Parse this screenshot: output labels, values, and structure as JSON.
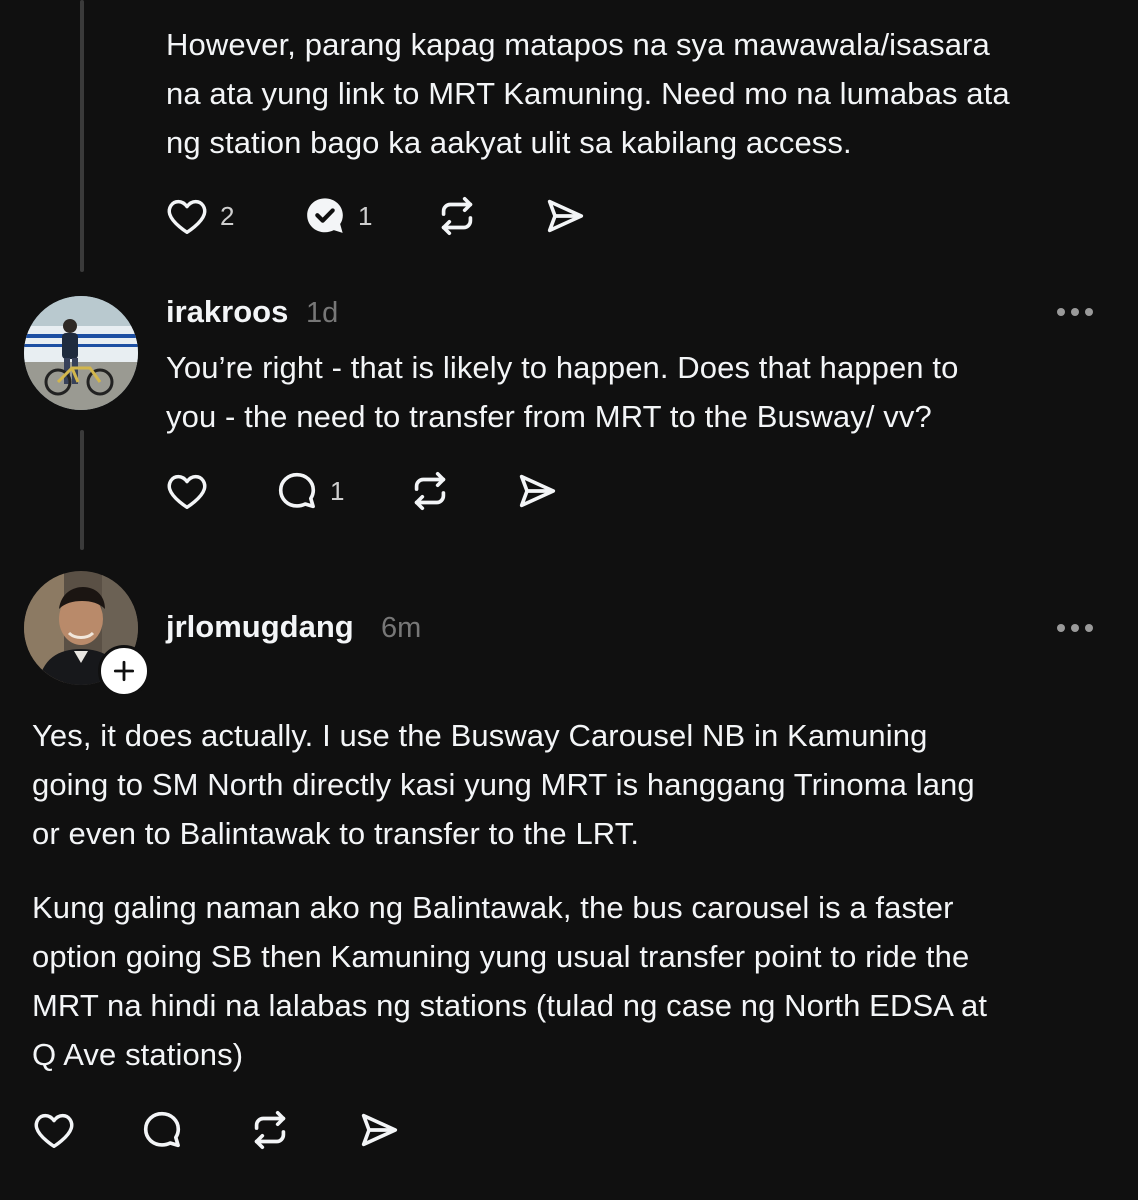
{
  "thread": [
    {
      "text_lines": [
        "However, parang kapag matapos na sya mawawala/isasara",
        "na ata yung link to MRT Kamuning. Need mo na lumabas ata",
        "ng station bago ka aakyat ulit sa kabilang access."
      ],
      "likes": "2",
      "replies": "1",
      "reply_icon": "reply-checked-icon"
    },
    {
      "username": "irakroos",
      "time": "1d",
      "text_lines": [
        "You’re right - that is likely to happen. Does that happen to",
        "you - the need to transfer from MRT to the Busway/ vv?"
      ],
      "likes": "",
      "replies": "1",
      "avatar_icon": "cyclist-avatar"
    },
    {
      "username": "jrlomugdang",
      "time": "6m",
      "paragraph1_lines": [
        "Yes, it does actually. I use the Busway Carousel NB in Kamuning",
        "going to SM North directly kasi yung MRT is hanggang Trinoma lang",
        "or even to Balintawak to transfer to the LRT."
      ],
      "paragraph2_lines": [
        "Kung galing naman ako ng Balintawak, the bus carousel is a faster",
        "option going SB then Kamuning yung usual transfer point to ride the",
        "MRT na hindi na lalabas ng stations (tulad ng case ng North EDSA at",
        "Q Ave stations)"
      ],
      "avatar_icon": "portrait-avatar",
      "follow_icon": "plus-icon"
    }
  ],
  "icons": {
    "like": "heart-icon",
    "reply": "comment-icon",
    "repost": "repost-icon",
    "share": "send-icon",
    "more": "more-options-icon"
  },
  "colors": {
    "background": "#101010",
    "text": "#f3f5f7",
    "muted": "#777777",
    "thread_line": "#3a3a3a"
  }
}
